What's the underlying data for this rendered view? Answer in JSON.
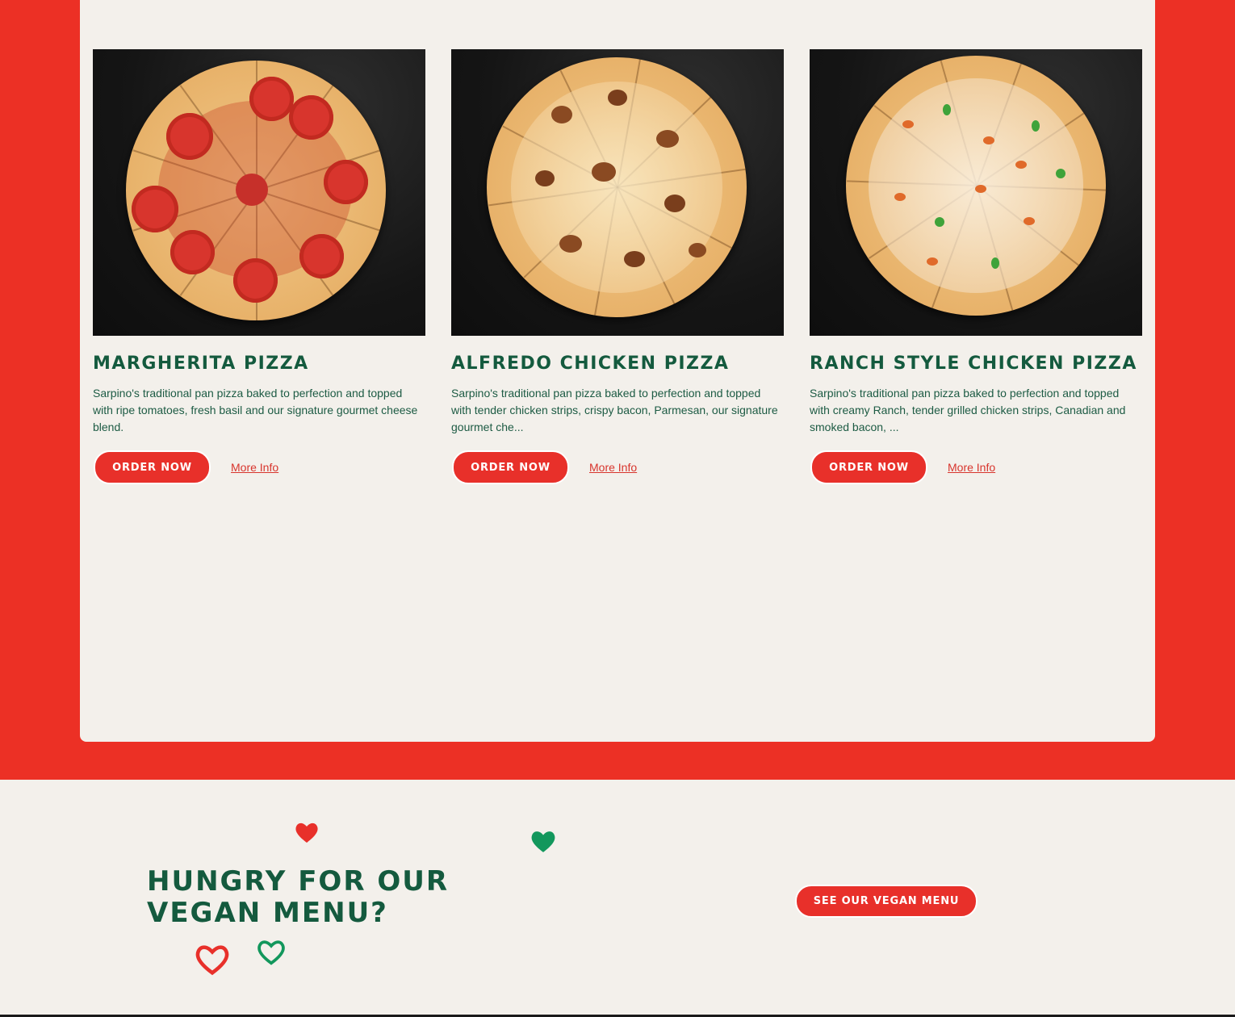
{
  "colors": {
    "brand_red": "#ec3025",
    "brand_green": "#145a3e",
    "panel_bg": "#f3f0eb"
  },
  "menu": {
    "items": [
      {
        "name": "Margherita Pizza",
        "description": "Sarpino's traditional pan pizza baked to perfection and topped with ripe tomatoes, fresh basil and our signature gourmet cheese blend.",
        "order_label": "Order Now",
        "more_label": "More Info",
        "image_icon": "pizza-margherita-image"
      },
      {
        "name": "Alfredo Chicken Pizza",
        "description": "Sarpino's traditional pan pizza baked to perfection and topped with tender chicken strips, crispy bacon, Parmesan, our signature gourmet che...",
        "order_label": "Order Now",
        "more_label": "More Info",
        "image_icon": "pizza-alfredo-image"
      },
      {
        "name": "Ranch Style Chicken Pizza",
        "description": "Sarpino's traditional pan pizza baked to perfection and topped with creamy Ranch, tender grilled chicken strips, Canadian and smoked bacon, ...",
        "order_label": "Order Now",
        "more_label": "More Info",
        "image_icon": "pizza-ranch-image"
      }
    ]
  },
  "vegan": {
    "title": "Hungry for our vegan menu?",
    "button_label": "See our vegan menu",
    "decor_icons": [
      "heart-icon",
      "heart-icon",
      "heart-outline-icon",
      "heart-outline-icon"
    ]
  }
}
